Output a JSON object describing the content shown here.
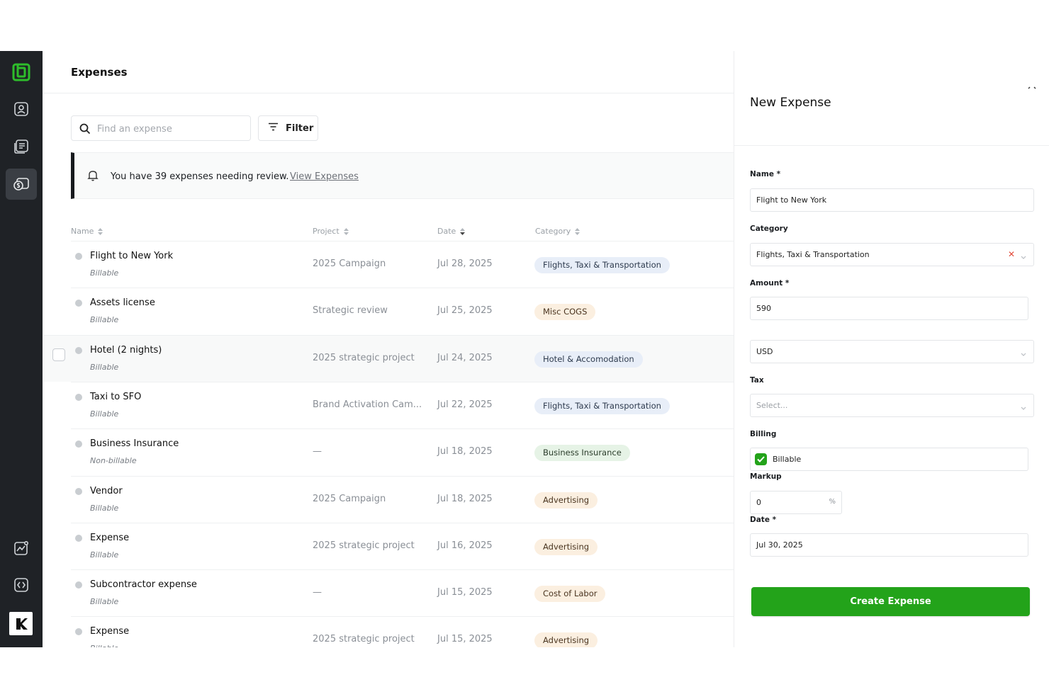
{
  "page": {
    "title": "Expenses"
  },
  "toolbar": {
    "search_placeholder": "Find an expense",
    "filter_label": "Filter"
  },
  "banner": {
    "message": "You have 39 expenses needing review.",
    "link_label": "View Expenses"
  },
  "table": {
    "columns": [
      "Name",
      "Project",
      "Date",
      "Category"
    ],
    "rows": [
      {
        "name": "Flight to New York",
        "billing": "Billable",
        "project": "2025 Campaign",
        "date": "Jul 28, 2025",
        "category": "Flights, Taxi & Transportation",
        "tag_bg": "#e8eef8",
        "tag_fg": "#2e3b4e"
      },
      {
        "name": "Assets license",
        "billing": "Billable",
        "project": "Strategic review",
        "date": "Jul 25, 2025",
        "category": "Misc COGS",
        "tag_bg": "#fbefe0",
        "tag_fg": "#4a3520"
      },
      {
        "name": "Hotel (2 nights)",
        "billing": "Billable",
        "project": "2025 strategic project",
        "date": "Jul 24, 2025",
        "category": "Hotel & Accomodation",
        "tag_bg": "#e8eef8",
        "tag_fg": "#2e3b4e"
      },
      {
        "name": "Taxi to SFO",
        "billing": "Billable",
        "project": "Brand Activation Cam...",
        "date": "Jul 22, 2025",
        "category": "Flights, Taxi & Transportation",
        "tag_bg": "#e8eef8",
        "tag_fg": "#2e3b4e"
      },
      {
        "name": "Business Insurance",
        "billing": "Non-billable",
        "project": "—",
        "date": "Jul 18, 2025",
        "category": "Business Insurance",
        "tag_bg": "#e6f3e6",
        "tag_fg": "#2c3e2c"
      },
      {
        "name": "Vendor",
        "billing": "Billable",
        "project": "2025 Campaign",
        "date": "Jul 18, 2025",
        "category": "Advertising",
        "tag_bg": "#fbefe0",
        "tag_fg": "#4a3520"
      },
      {
        "name": "Expense",
        "billing": "Billable",
        "project": "2025 strategic project",
        "date": "Jul 16, 2025",
        "category": "Advertising",
        "tag_bg": "#fbefe0",
        "tag_fg": "#4a3520"
      },
      {
        "name": "Subcontractor expense",
        "billing": "Billable",
        "project": "—",
        "date": "Jul 15, 2025",
        "category": "Cost of Labor",
        "tag_bg": "#fbefe0",
        "tag_fg": "#4a3520"
      },
      {
        "name": "Expense",
        "billing": "Billable",
        "project": "2025 strategic project",
        "date": "Jul 15, 2025",
        "category": "Advertising",
        "tag_bg": "#fbefe0",
        "tag_fg": "#4a3520"
      }
    ]
  },
  "panel": {
    "title": "New Expense",
    "name_label": "Name *",
    "name_value": "Flight to New York",
    "category_label": "Category",
    "category_value": "Flights, Taxi & Transportation",
    "amount_label": "Amount *",
    "amount_value": "590",
    "currency_value": "USD",
    "tax_label": "Tax",
    "tax_placeholder": "Select...",
    "billing_label": "Billing",
    "billable_label": "Billable",
    "billable_checked": true,
    "markup_label": "Markup",
    "markup_value": "0",
    "markup_unit": "%",
    "date_label": "Date *",
    "date_value": "Jul 30, 2025",
    "create_label": "Create Expense"
  },
  "sidebar": {
    "items": [
      {
        "icon": "logo-icon"
      },
      {
        "icon": "contacts-icon"
      },
      {
        "icon": "documents-icon"
      },
      {
        "icon": "expenses-icon",
        "active": true
      },
      {
        "icon": "reports-icon"
      },
      {
        "icon": "integrations-icon"
      },
      {
        "icon": "brand-logo-icon"
      }
    ]
  },
  "colors": {
    "accent": "#23a31a",
    "sidebar_bg": "#1f2226",
    "logo_green": "#2ebd2b"
  }
}
